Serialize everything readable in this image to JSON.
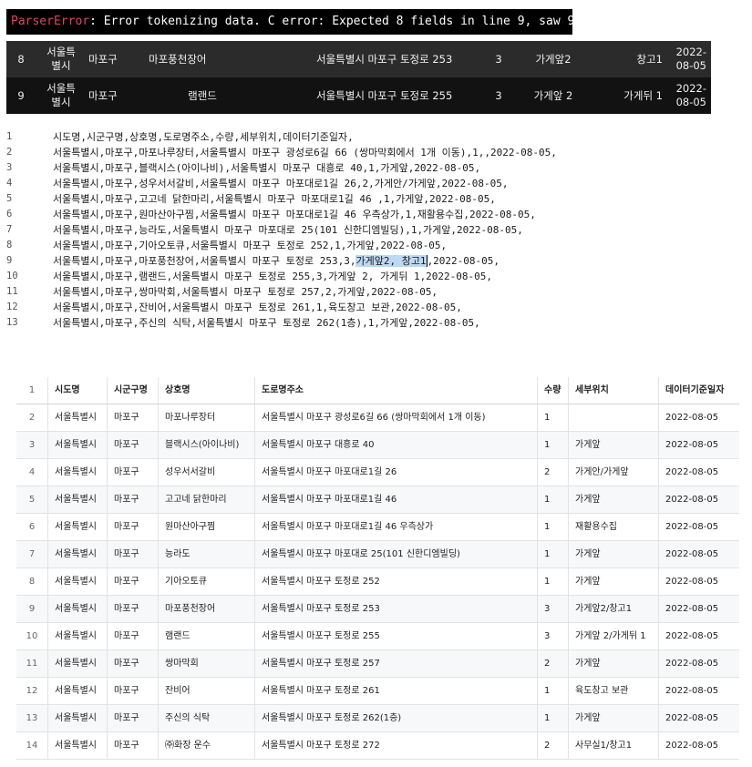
{
  "error": {
    "type": "ParserError",
    "message": ": Error tokenizing data. C error: Expected 8 fields in line 9, saw 9"
  },
  "dark_table": {
    "rows": [
      {
        "idx": "8",
        "sido": "서울특별시",
        "gu": "마포구",
        "name": "마포풍천장어",
        "addr": "서울특별시 마포구 토정로 253",
        "qty": "3",
        "pos1": "가게앞2",
        "pos2": "창고1",
        "date": "2022-08-05"
      },
      {
        "idx": "9",
        "sido": "서울특별시",
        "gu": "마포구",
        "name": "램랜드",
        "addr": "서울특별시 마포구 토정로 255",
        "qty": "3",
        "pos1": "가게앞 2",
        "pos2": "가게뒤 1",
        "date": "2022-08-05"
      }
    ]
  },
  "raw_csv": {
    "lines": [
      {
        "n": "1",
        "text": "시도명,시군구명,상호명,도로명주소,수량,세부위치,데이터기준일자,"
      },
      {
        "n": "2",
        "text": "서울특별시,마포구,마포나루장터,서울특별시 마포구 광성로6길 66 (쌍마막회에서 1개 이동),1,,2022-08-05,"
      },
      {
        "n": "3",
        "text": "서울특별시,마포구,블랙시스(아이나비),서울특별시 마포구 대흥로 40,1,가게앞,2022-08-05,"
      },
      {
        "n": "4",
        "text": "서울특별시,마포구,성우서서갈비,서울특별시 마포구 마포대로1길 26,2,가게안/가게앞,2022-08-05,"
      },
      {
        "n": "5",
        "text": "서울특별시,마포구,고고네 닭한마리,서울특별시 마포구 마포대로1길 46 ,1,가게앞,2022-08-05,"
      },
      {
        "n": "6",
        "text": "서울특별시,마포구,원마산아구찜,서울특별시 마포구 마포대로1길 46 우측상가,1,재활용수집,2022-08-05,"
      },
      {
        "n": "7",
        "text": "서울특별시,마포구,능라도,서울특별시 마포구 마포대로 25(101 신한디엠빌딩),1,가게앞,2022-08-05,"
      },
      {
        "n": "8",
        "text": "서울특별시,마포구,기아오토큐,서울특별시 마포구 토정로 252,1,가게앞,2022-08-05,"
      },
      {
        "n": "9",
        "pre": "서울특별시,마포구,마포풍천장어,서울특별시 마포구 토정로 253,3,",
        "hl": "가게앞2, 창고1",
        "post": ",2022-08-05,"
      },
      {
        "n": "10",
        "text": "서울특별시,마포구,램랜드,서울특별시 마포구 토정로 255,3,가게앞 2, 가게뒤 1,2022-08-05,"
      },
      {
        "n": "11",
        "text": "서울특별시,마포구,쌍마막회,서울특별시 마포구 토정로 257,2,가게앞,2022-08-05,"
      },
      {
        "n": "12",
        "text": "서울특별시,마포구,잔비어,서울특별시 마포구 토정로 261,1,육도창고 보관,2022-08-05,"
      },
      {
        "n": "13",
        "text": "서울특별시,마포구,주신의 식탁,서울특별시 마포구 토정로 262(1층),1,가게앞,2022-08-05,"
      }
    ]
  },
  "grid": {
    "header": {
      "idx": "1",
      "cols": [
        "시도명",
        "시군구명",
        "상호명",
        "도로명주소",
        "수량",
        "세부위치",
        "데이터기준일자"
      ]
    },
    "rows": [
      {
        "idx": "2",
        "cols": [
          "서울특별시",
          "마포구",
          "마포나루장터",
          "서울특별시 마포구 광성로6길 66 (쌍마막회에서 1개 이동)",
          "1",
          "",
          "2022-08-05"
        ]
      },
      {
        "idx": "3",
        "cols": [
          "서울특별시",
          "마포구",
          "블랙시스(아이나비)",
          "서울특별시 마포구 대흥로 40",
          "1",
          "가게앞",
          "2022-08-05"
        ]
      },
      {
        "idx": "4",
        "cols": [
          "서울특별시",
          "마포구",
          "성우서서갈비",
          "서울특별시 마포구 마포대로1길 26",
          "2",
          "가게안/가게앞",
          "2022-08-05"
        ]
      },
      {
        "idx": "5",
        "cols": [
          "서울특별시",
          "마포구",
          "고고네 닭한마리",
          "서울특별시 마포구 마포대로1길 46",
          "1",
          "가게앞",
          "2022-08-05"
        ]
      },
      {
        "idx": "6",
        "cols": [
          "서울특별시",
          "마포구",
          "원마산아구찜",
          "서울특별시 마포구 마포대로1길 46 우측상가",
          "1",
          "재활용수집",
          "2022-08-05"
        ]
      },
      {
        "idx": "7",
        "cols": [
          "서울특별시",
          "마포구",
          "능라도",
          "서울특별시 마포구 마포대로 25(101 신한디엠빌딩)",
          "1",
          "가게앞",
          "2022-08-05"
        ]
      },
      {
        "idx": "8",
        "cols": [
          "서울특별시",
          "마포구",
          "기아오토큐",
          "서울특별시 마포구 토정로 252",
          "1",
          "가게앞",
          "2022-08-05"
        ]
      },
      {
        "idx": "9",
        "cols": [
          "서울특별시",
          "마포구",
          "마포풍천장어",
          "서울특별시 마포구 토정로 253",
          "3",
          "가게앞2/창고1",
          "2022-08-05"
        ]
      },
      {
        "idx": "10",
        "cols": [
          "서울특별시",
          "마포구",
          "램랜드",
          "서울특별시 마포구 토정로 255",
          "3",
          "가게앞 2/가게뒤 1",
          "2022-08-05"
        ]
      },
      {
        "idx": "11",
        "cols": [
          "서울특별시",
          "마포구",
          "쌍마막회",
          "서울특별시 마포구 토정로 257",
          "2",
          "가게앞",
          "2022-08-05"
        ]
      },
      {
        "idx": "12",
        "cols": [
          "서울특별시",
          "마포구",
          "잔비어",
          "서울특별시 마포구 토정로 261",
          "1",
          "육도창고 보관",
          "2022-08-05"
        ]
      },
      {
        "idx": "13",
        "cols": [
          "서울특별시",
          "마포구",
          "주신의 식탁",
          "서울특별시 마포구 토정로 262(1층)",
          "1",
          "가게앞",
          "2022-08-05"
        ]
      },
      {
        "idx": "14",
        "cols": [
          "서울특별시",
          "마포구",
          "㈜화장 운수",
          "서울특별시 마포구 토정로 272",
          "2",
          "사무실1/창고1",
          "2022-08-05"
        ]
      }
    ]
  },
  "colors": {
    "error_type": "#e0445f",
    "highlight": "#bcd8f5"
  }
}
